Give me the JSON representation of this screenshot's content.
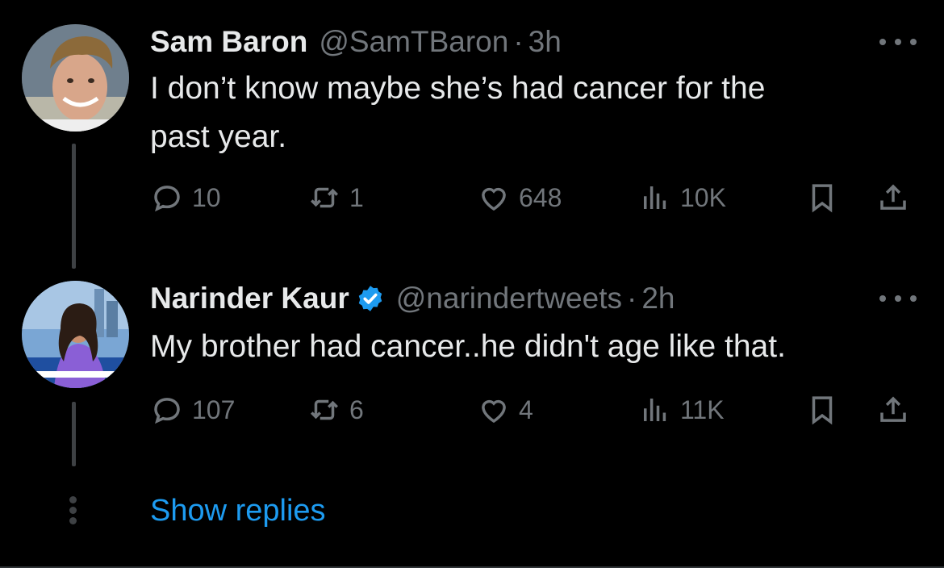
{
  "tweets": [
    {
      "name": "Sam Baron",
      "handle": "@SamTBaron",
      "sep": "·",
      "time": "3h",
      "verified": false,
      "text_lines": [
        "I don’t know maybe she’s had cancer for the",
        "past year."
      ],
      "replies": "10",
      "retweets": "1",
      "likes": "648",
      "views": "10K"
    },
    {
      "name": "Narinder Kaur",
      "handle": "@narindertweets",
      "sep": "·",
      "time": "2h",
      "verified": true,
      "text_lines": [
        "My brother had cancer..he didn't age like that."
      ],
      "replies": "107",
      "retweets": "6",
      "likes": "4",
      "views": "11K"
    }
  ],
  "show_replies": "Show replies",
  "colors": {
    "background": "#000000",
    "text": "#e7e9ea",
    "muted": "#71767b",
    "link": "#1d9bf0",
    "verified": "#1d9bf0"
  },
  "icons": [
    "reply-icon",
    "retweet-icon",
    "like-icon",
    "views-icon",
    "bookmark-icon",
    "share-icon",
    "more-icon",
    "verified-badge-icon"
  ]
}
